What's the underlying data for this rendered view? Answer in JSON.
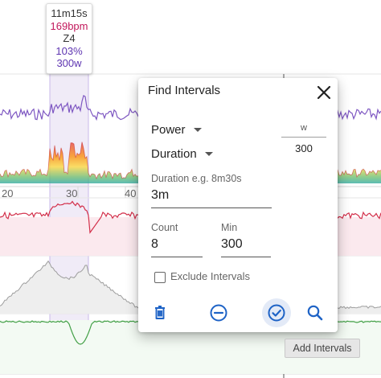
{
  "hover_tooltip": {
    "duration": "11m15s",
    "heart_rate": "169bpm",
    "zone": "Z4",
    "percent": "103%",
    "power": "300w"
  },
  "x_axis_labels": [
    "20",
    "30",
    "40"
  ],
  "dialog": {
    "title": "Find Intervals",
    "metric_select": "Power",
    "mode_select": "Duration",
    "unit_label": "w",
    "unit_value": "300",
    "duration_label": "Duration e.g. 8m30s",
    "duration_value": "3m",
    "count_label": "Count",
    "count_value": "8",
    "min_label": "Min",
    "min_value": "300",
    "exclude_label": "Exclude Intervals",
    "exclude_checked": false,
    "icons": {
      "close": "close-icon",
      "delete": "trash-icon",
      "remove": "minus-circle-icon",
      "confirm": "check-circle-icon",
      "search": "search-icon"
    }
  },
  "action_tooltip": "Add Intervals",
  "colors": {
    "accent_blue": "#1e63c6",
    "power_purple": "#7e57c2",
    "heart_red": "#d32f4a",
    "elevation_gray": "#9e9e9e",
    "balance_green": "#43a047",
    "highlight": "#ede7f6"
  }
}
